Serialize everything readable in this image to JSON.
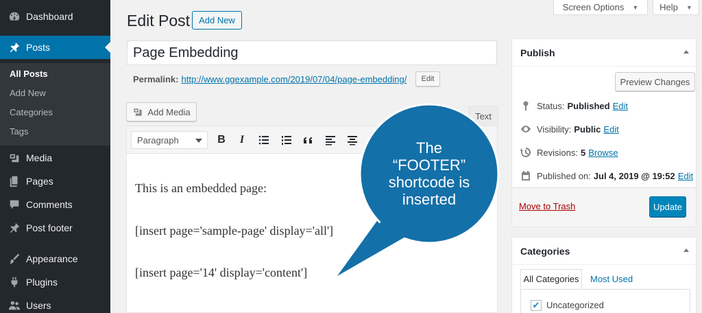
{
  "sidebar": {
    "items": [
      {
        "label": "Dashboard",
        "icon": "dashboard-icon"
      },
      {
        "label": "Posts",
        "icon": "pin-icon"
      },
      {
        "label": "Media",
        "icon": "media-icon"
      },
      {
        "label": "Pages",
        "icon": "pages-icon"
      },
      {
        "label": "Comments",
        "icon": "comments-icon"
      },
      {
        "label": "Post footer",
        "icon": "pin-icon"
      },
      {
        "label": "Appearance",
        "icon": "brush-icon"
      },
      {
        "label": "Plugins",
        "icon": "plugin-icon"
      },
      {
        "label": "Users",
        "icon": "users-icon"
      }
    ],
    "submenu": [
      "All Posts",
      "Add New",
      "Categories",
      "Tags"
    ]
  },
  "top": {
    "screen_options": "Screen Options",
    "help": "Help"
  },
  "header": {
    "title": "Edit Post",
    "add_new": "Add New"
  },
  "post": {
    "title": "Page Embedding",
    "permalink_label": "Permalink:",
    "permalink_url": "http://www.ggexample.com/2019/07/04/page-embedding/",
    "permalink_edit": "Edit"
  },
  "editor": {
    "add_media": "Add Media",
    "text_tab": "Text",
    "format": "Paragraph",
    "lines": [
      "This is an embedded page:",
      "[insert page='sample-page' display='all']",
      "[insert page='14' display='content']"
    ]
  },
  "callout": {
    "lines": [
      "The",
      "“FOOTER”",
      "shortcode is",
      "inserted"
    ],
    "color": "#1470a8"
  },
  "publish": {
    "title": "Publish",
    "preview": "Preview Changes",
    "status_label": "Status:",
    "status_value": "Published",
    "visibility_label": "Visibility:",
    "visibility_value": "Public",
    "revisions_label": "Revisions:",
    "revisions_value": "5",
    "revisions_link": "Browse",
    "published_label": "Published on:",
    "published_value": "Jul 4, 2019 @ 19:52",
    "edit": "Edit",
    "trash": "Move to Trash",
    "update": "Update"
  },
  "categories": {
    "title": "Categories",
    "tab_all": "All Categories",
    "tab_used": "Most Used",
    "items": [
      {
        "label": "Uncategorized",
        "checked": true
      }
    ]
  }
}
